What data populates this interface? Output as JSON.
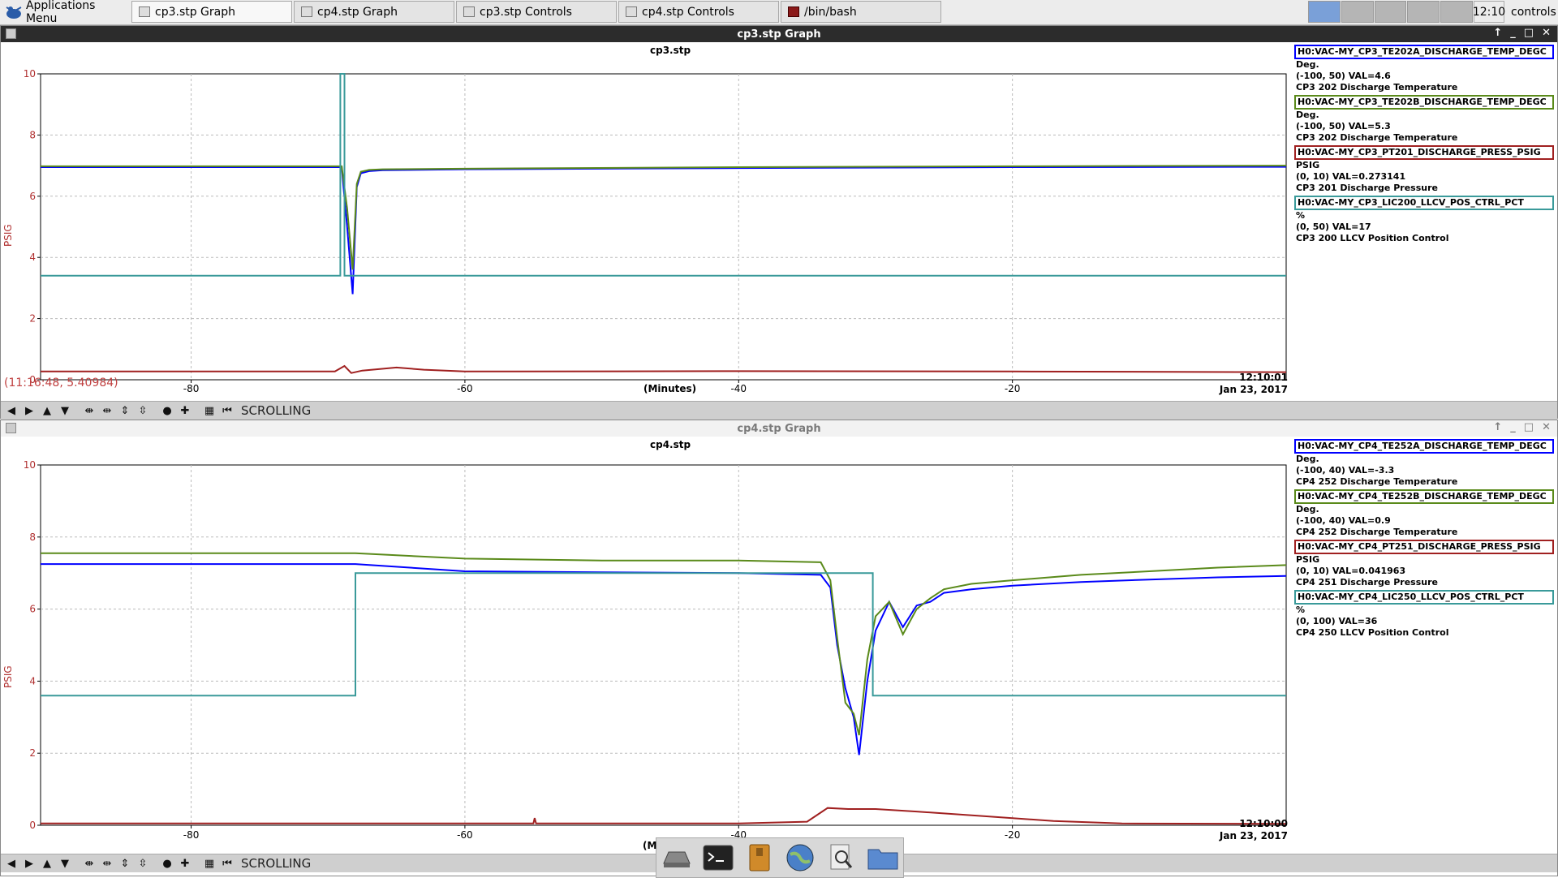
{
  "taskbar": {
    "app_menu": "Applications Menu",
    "tasks": [
      {
        "label": "cp3.stp Graph",
        "active": true
      },
      {
        "label": "cp4.stp Graph",
        "active": false
      },
      {
        "label": "cp3.stp Controls",
        "active": false
      },
      {
        "label": "cp4.stp Controls",
        "active": false
      },
      {
        "label": "/bin/bash",
        "active": false
      }
    ],
    "clock": "12:10",
    "user": "controls"
  },
  "windows": [
    {
      "title": "cp3.stp Graph",
      "active": true,
      "cursor_readout": "(11:16:48, 5.40984)",
      "mode": "SCROLLING",
      "chart_data": {
        "type": "line",
        "title": "cp3.stp",
        "xlabel": "(Minutes)",
        "ylabel": "PSIG",
        "xlim": [
          -91,
          0
        ],
        "ylim": [
          0,
          10
        ],
        "xticks": [
          -80,
          -60,
          -40,
          -20
        ],
        "yticks": [
          0,
          2,
          4,
          6,
          8,
          10
        ],
        "timestamp": "12:10:01",
        "date": "Jan 23, 2017",
        "grid": true,
        "series": [
          {
            "name": "H0:VAC-MY_CP3_TE202A_DISCHARGE_TEMP_DEGC",
            "color": "#0000ff",
            "unit": "Deg.",
            "range": "(-100, 50)",
            "value": "VAL=4.6",
            "desc": "CP3 202 Discharge Temperature",
            "x": [
              -91,
              -69,
              -68.6,
              -68.2,
              -67.9,
              -67.6,
              -67,
              -66,
              -60,
              -40,
              -20,
              0
            ],
            "y": [
              6.95,
              6.95,
              5.0,
              2.8,
              6.3,
              6.75,
              6.82,
              6.85,
              6.88,
              6.92,
              6.95,
              6.96
            ]
          },
          {
            "name": "H0:VAC-MY_CP3_TE202B_DISCHARGE_TEMP_DEGC",
            "color": "#5a8a1a",
            "unit": "Deg.",
            "range": "(-100, 50)",
            "value": "VAL=5.3",
            "desc": "CP3 202 Discharge Temperature",
            "x": [
              -91,
              -69,
              -68.6,
              -68.2,
              -67.9,
              -67.6,
              -67,
              -66,
              -60,
              -40,
              -20,
              0
            ],
            "y": [
              6.98,
              6.98,
              5.6,
              3.6,
              6.4,
              6.8,
              6.86,
              6.88,
              6.9,
              6.95,
              6.98,
              7.0
            ]
          },
          {
            "name": "H0:VAC-MY_CP3_PT201_DISCHARGE_PRESS_PSIG",
            "color": "#a02020",
            "unit": "PSIG",
            "range": "(0, 10)",
            "value": "VAL=0.273141",
            "desc": "CP3 201 Discharge Pressure",
            "x": [
              -91,
              -69.5,
              -68.8,
              -68.3,
              -67.5,
              -65,
              -63,
              -60,
              -40,
              -20,
              0
            ],
            "y": [
              0.27,
              0.27,
              0.45,
              0.22,
              0.3,
              0.4,
              0.33,
              0.27,
              0.28,
              0.27,
              0.25
            ]
          },
          {
            "name": "H0:VAC-MY_CP3_LIC200_LLCV_POS_CTRL_PCT",
            "color": "#3a9a9a",
            "unit": "%",
            "range": "(0, 50)",
            "value": "VAL=17",
            "desc": "CP3 200 LLCV Position Control",
            "x": [
              -91,
              -69.1,
              -69.1,
              -68.8,
              -68.8,
              0
            ],
            "y": [
              3.4,
              3.4,
              10,
              10,
              3.4,
              3.4
            ]
          }
        ]
      }
    },
    {
      "title": "cp4.stp Graph",
      "active": false,
      "mode": "SCROLLING",
      "chart_data": {
        "type": "line",
        "title": "cp4.stp",
        "xlabel": "(Minutes)",
        "ylabel": "PSIG",
        "xlim": [
          -91,
          0
        ],
        "ylim": [
          0,
          10
        ],
        "xticks": [
          -80,
          -60,
          -40,
          -20
        ],
        "yticks": [
          0,
          2,
          4,
          6,
          8,
          10
        ],
        "timestamp": "12:10:00",
        "date": "Jan 23, 2017",
        "grid": true,
        "series": [
          {
            "name": "H0:VAC-MY_CP4_TE252A_DISCHARGE_TEMP_DEGC",
            "color": "#0000ff",
            "unit": "Deg.",
            "range": "(-100, 40)",
            "value": "VAL=-3.3",
            "desc": "CP4 252 Discharge Temperature",
            "x": [
              -91,
              -68,
              -60,
              -50,
              -40,
              -34,
              -33.3,
              -32.8,
              -32.2,
              -31.6,
              -31.2,
              -30.6,
              -30,
              -29,
              -28,
              -27,
              -26,
              -25,
              -23,
              -20,
              -15,
              -10,
              -5,
              0
            ],
            "y": [
              7.25,
              7.25,
              7.05,
              7.02,
              7.0,
              6.95,
              6.6,
              5.0,
              3.8,
              3.0,
              1.95,
              4.0,
              5.4,
              6.2,
              5.5,
              6.1,
              6.2,
              6.45,
              6.55,
              6.65,
              6.75,
              6.82,
              6.88,
              6.92
            ]
          },
          {
            "name": "H0:VAC-MY_CP4_TE252B_DISCHARGE_TEMP_DEGC",
            "color": "#5a8a1a",
            "unit": "Deg.",
            "range": "(-100, 40)",
            "value": "VAL=0.9",
            "desc": "CP4 252 Discharge Temperature",
            "x": [
              -91,
              -68,
              -60,
              -50,
              -40,
              -34,
              -33.3,
              -32.8,
              -32.2,
              -31.6,
              -31.2,
              -30.6,
              -30,
              -29,
              -28,
              -27,
              -26,
              -25,
              -23,
              -20,
              -15,
              -10,
              -5,
              0
            ],
            "y": [
              7.55,
              7.55,
              7.4,
              7.35,
              7.35,
              7.3,
              6.8,
              5.2,
              3.4,
              3.1,
              2.5,
              4.6,
              5.8,
              6.2,
              5.3,
              6.0,
              6.3,
              6.55,
              6.7,
              6.8,
              6.95,
              7.05,
              7.15,
              7.22
            ]
          },
          {
            "name": "H0:VAC-MY_CP4_PT251_DISCHARGE_PRESS_PSIG",
            "color": "#a02020",
            "unit": "PSIG",
            "range": "(0, 10)",
            "value": "VAL=0.041963",
            "desc": "CP4 251 Discharge Pressure",
            "x": [
              -91,
              -60,
              -55,
              -54.9,
              -54.8,
              -40,
              -35,
              -33.5,
              -32,
              -30,
              -27,
              -22,
              -17,
              -12,
              0
            ],
            "y": [
              0.05,
              0.05,
              0.05,
              0.2,
              0.05,
              0.05,
              0.1,
              0.48,
              0.45,
              0.45,
              0.38,
              0.25,
              0.12,
              0.05,
              0.04
            ]
          },
          {
            "name": "H0:VAC-MY_CP4_LIC250_LLCV_POS_CTRL_PCT",
            "color": "#3a9a9a",
            "unit": "%",
            "range": "(0, 100)",
            "value": "VAL=36",
            "desc": "CP4 250 LLCV Position Control",
            "x": [
              -91,
              -68,
              -68,
              -30.2,
              -30.2,
              0
            ],
            "y": [
              3.6,
              3.6,
              7.0,
              7.0,
              3.6,
              3.6
            ]
          }
        ]
      }
    }
  ],
  "toolbar_icons": [
    "arrow-left-icon",
    "arrow-right-icon",
    "arrow-up-icon",
    "arrow-down-icon",
    "expand-horizontal-icon",
    "compress-horizontal-icon",
    "expand-vertical-icon",
    "compress-vertical-icon",
    "record-icon",
    "add-icon",
    "chart-icon",
    "rewind-icon"
  ],
  "dock": {
    "items": [
      "drive-icon",
      "terminal-icon",
      "archive-icon",
      "browser-icon",
      "search-file-icon",
      "folder-icon"
    ],
    "hidden_label": "(M"
  }
}
